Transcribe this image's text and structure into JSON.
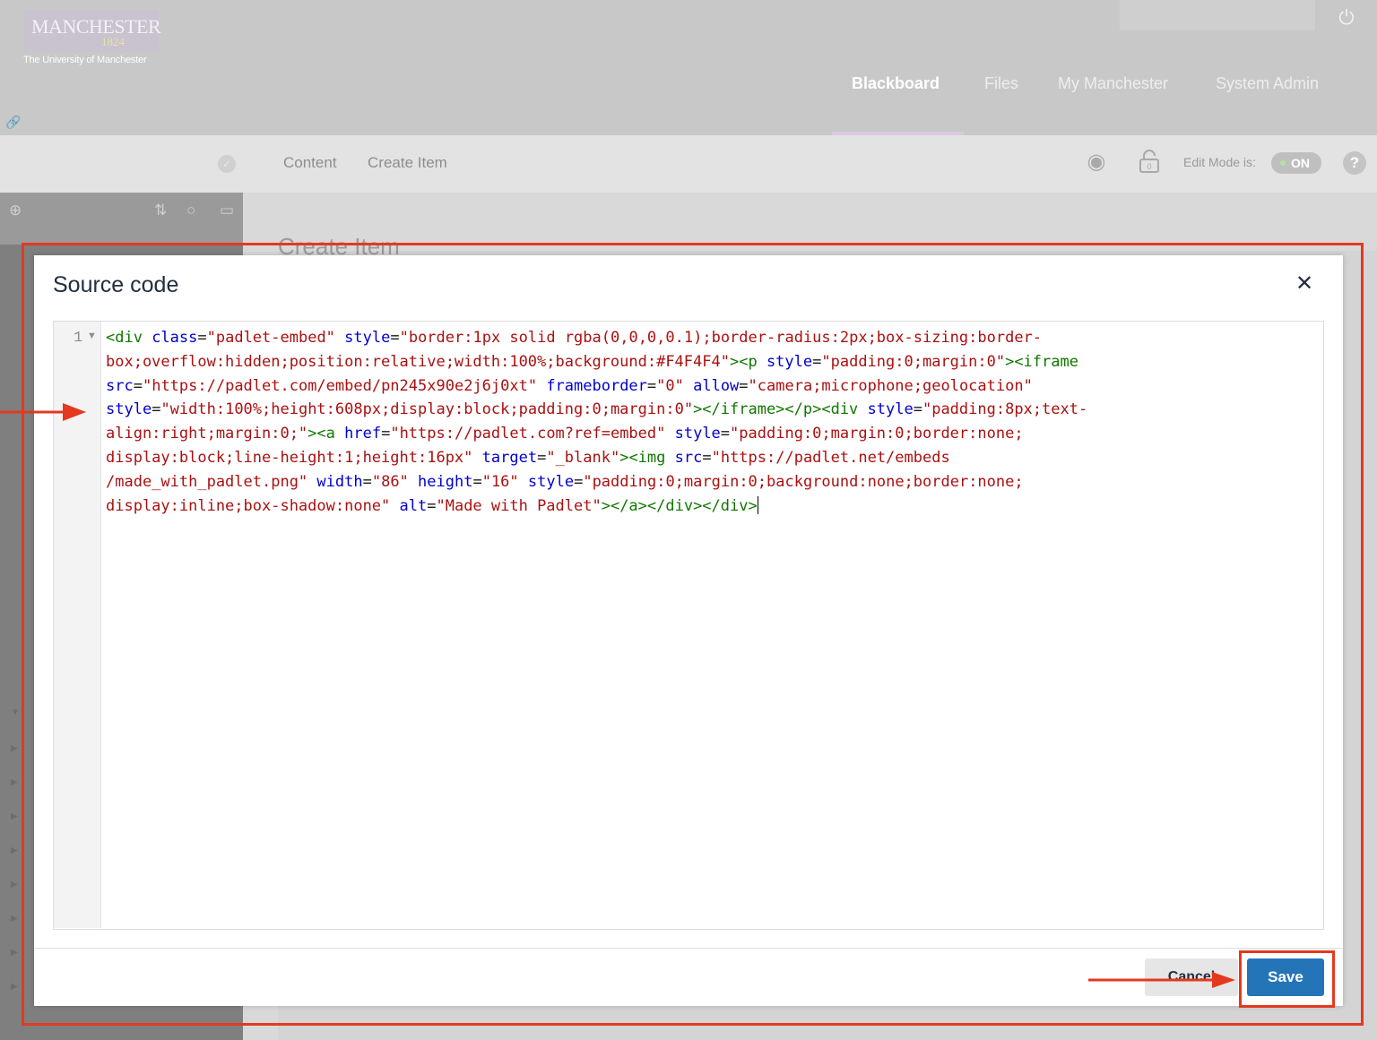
{
  "header": {
    "logo_name": "MANCHESTER",
    "logo_year": "1824",
    "logo_subtitle": "The University of Manchester",
    "nav": [
      "Blackboard",
      "Files",
      "My Manchester",
      "System Admin"
    ],
    "active_nav": "Blackboard"
  },
  "toolbar": {
    "breadcrumbs": [
      "Content",
      "Create Item"
    ],
    "edit_mode_label": "Edit Mode is:",
    "edit_mode_value": "ON",
    "lock_count": "0",
    "help_label": "?"
  },
  "background": {
    "page_title": "Create Item"
  },
  "modal": {
    "title": "Source code",
    "line_number": "1",
    "code_lines": [
      [
        [
          "t",
          "<div "
        ],
        [
          "a",
          "class"
        ],
        [
          "p",
          "="
        ],
        [
          "s",
          "\"padlet-embed\" "
        ],
        [
          "a",
          "style"
        ],
        [
          "p",
          "="
        ],
        [
          "s",
          "\"border:1px solid rgba(0,0,0,0.1);border-radius:2px;box-sizing:border-"
        ]
      ],
      [
        [
          "s",
          "box;overflow:hidden;position:relative;width:100%;background:#F4F4F4\""
        ],
        [
          "t",
          "><p "
        ],
        [
          "a",
          "style"
        ],
        [
          "p",
          "="
        ],
        [
          "s",
          "\"padding:0;margin:0\""
        ],
        [
          "t",
          "><iframe"
        ]
      ],
      [
        [
          "a",
          "src"
        ],
        [
          "p",
          "="
        ],
        [
          "s",
          "\"https://padlet.com/embed/pn245x90e2j6j0xt\" "
        ],
        [
          "a",
          "frameborder"
        ],
        [
          "p",
          "="
        ],
        [
          "s",
          "\"0\" "
        ],
        [
          "a",
          "allow"
        ],
        [
          "p",
          "="
        ],
        [
          "s",
          "\"camera;microphone;geolocation\""
        ]
      ],
      [
        [
          "a",
          "style"
        ],
        [
          "p",
          "="
        ],
        [
          "s",
          "\"width:100%;height:608px;display:block;padding:0;margin:0\""
        ],
        [
          "t",
          "></iframe></p><div "
        ],
        [
          "a",
          "style"
        ],
        [
          "p",
          "="
        ],
        [
          "s",
          "\"padding:8px;text-"
        ]
      ],
      [
        [
          "s",
          "align:right;margin:0;\""
        ],
        [
          "t",
          "><a "
        ],
        [
          "a",
          "href"
        ],
        [
          "p",
          "="
        ],
        [
          "s",
          "\"https://padlet.com?ref=embed\" "
        ],
        [
          "a",
          "style"
        ],
        [
          "p",
          "="
        ],
        [
          "s",
          "\"padding:0;margin:0;border:none;"
        ]
      ],
      [
        [
          "s",
          "display:block;line-height:1;height:16px\" "
        ],
        [
          "a",
          "target"
        ],
        [
          "p",
          "="
        ],
        [
          "s",
          "\"_blank\""
        ],
        [
          "t",
          "><img "
        ],
        [
          "a",
          "src"
        ],
        [
          "p",
          "="
        ],
        [
          "s",
          "\"https://padlet.net/embeds"
        ]
      ],
      [
        [
          "s",
          "/made_with_padlet.png\" "
        ],
        [
          "a",
          "width"
        ],
        [
          "p",
          "="
        ],
        [
          "s",
          "\"86\" "
        ],
        [
          "a",
          "height"
        ],
        [
          "p",
          "="
        ],
        [
          "s",
          "\"16\" "
        ],
        [
          "a",
          "style"
        ],
        [
          "p",
          "="
        ],
        [
          "s",
          "\"padding:0;margin:0;background:none;border:none;"
        ]
      ],
      [
        [
          "s",
          "display:inline;box-shadow:none\" "
        ],
        [
          "a",
          "alt"
        ],
        [
          "p",
          "="
        ],
        [
          "s",
          "\"Made with Padlet\""
        ],
        [
          "t",
          "></a></div></div>"
        ]
      ]
    ],
    "cancel_label": "Cancel",
    "save_label": "Save"
  },
  "colors": {
    "tag": "#117700",
    "attribute": "#0000cc",
    "string": "#aa1111",
    "save_button": "#2475b8",
    "annotation": "#e4391f"
  },
  "icons": [
    "power-icon",
    "link-icon",
    "check-icon",
    "eye-icon",
    "lock-icon",
    "help-icon",
    "add-icon",
    "sort-icon",
    "refresh-icon",
    "folder-icon",
    "close-icon",
    "fold-caret-icon",
    "arrow-icon"
  ]
}
